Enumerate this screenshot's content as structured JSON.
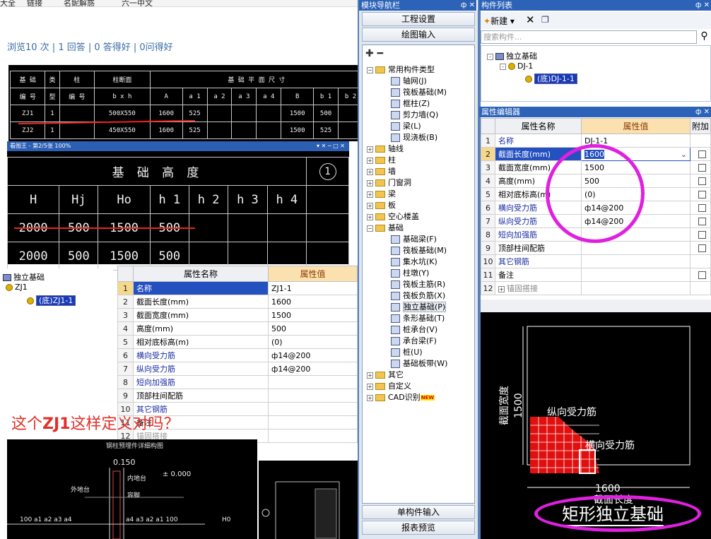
{
  "browser_bar": {
    "items": [
      "大全",
      "链接",
      "名妮解惑",
      "六一中文"
    ]
  },
  "stats": "浏览10 次 | 1 回答 | 0 答得好 | 0问得好",
  "cad_table1": {
    "header_row1": [
      "基 础",
      "类",
      "柱",
      "柱断面",
      "基 础 平 面 尺 寸"
    ],
    "header_row2": [
      "编 号",
      "型",
      "编 号",
      "b x h",
      "A",
      "a 1",
      "a 2",
      "a 3",
      "a 4",
      "B",
      "b 1",
      "b 2"
    ],
    "rows": [
      [
        "ZJ1",
        "1",
        "",
        "500X550",
        "1600",
        "525",
        "",
        "",
        "",
        "1500",
        "500",
        ""
      ],
      [
        "ZJ2",
        "1",
        "",
        "450X550",
        "1600",
        "525",
        "",
        "",
        "",
        "1500",
        "525",
        ""
      ]
    ]
  },
  "cad_window2": {
    "title": "看图王 - 第2/5张 100%",
    "heading": "基 础 高 度",
    "cols": [
      "H",
      "Hj",
      "Ho",
      "h 1",
      "h 2",
      "h 3",
      "h 4"
    ],
    "circle": "1",
    "rows": [
      [
        "2000",
        "500",
        "1500",
        "500",
        "",
        "",
        ""
      ],
      [
        "2000",
        "500",
        "1500",
        "500",
        "",
        "",
        ""
      ]
    ]
  },
  "left_tree": {
    "root": "独立基础",
    "child": "ZJ1",
    "leaf": "(底)ZJ1-1"
  },
  "left_props": {
    "head_name": "属性名称",
    "head_value": "属性值",
    "rows": [
      [
        "1",
        "名称",
        "ZJ1-1"
      ],
      [
        "2",
        "截面长度(mm)",
        "1600"
      ],
      [
        "3",
        "截面宽度(mm)",
        "1500"
      ],
      [
        "4",
        "高度(mm)",
        "500"
      ],
      [
        "5",
        "相对底标高(m)",
        "(0)"
      ],
      [
        "6",
        "横向受力筋",
        "ф14@200"
      ],
      [
        "7",
        "纵向受力筋",
        "ф14@200"
      ],
      [
        "8",
        "短向加强筋",
        ""
      ],
      [
        "9",
        "顶部柱间配筋",
        ""
      ],
      [
        "10",
        "其它钢筋",
        ""
      ],
      [
        "11",
        "备注",
        ""
      ],
      [
        "12",
        "锚固搭接",
        ""
      ]
    ]
  },
  "question": {
    "pre": "这个",
    "bold": "ZJ1",
    "post": "这样定义对吗？"
  },
  "drawing_labels": {
    "title": "钢柱预埋件详细构图",
    "elev": "0.150",
    "elev2": "± 0.000",
    "outer": "外地台",
    "inner": "内地台",
    "steps": "容脚",
    "dims": "100 a1 a2 a3 a4",
    "dims2": "a4 a3 a2 a1 100",
    "ho": "H0"
  },
  "module_nav": {
    "title": "模块导航栏",
    "btn_settings": "工程设置",
    "btn_drawing": "绘图输入",
    "btn_single": "单构件输入",
    "btn_report": "报表预览"
  },
  "nav_tree": [
    {
      "lvl": 0,
      "exp": "-",
      "kind": "folder",
      "label": "常用构件类型"
    },
    {
      "lvl": 1,
      "kind": "item",
      "label": "轴网(J)"
    },
    {
      "lvl": 1,
      "kind": "item",
      "label": "筏板基础(M)"
    },
    {
      "lvl": 1,
      "kind": "item",
      "label": "框柱(Z)"
    },
    {
      "lvl": 1,
      "kind": "item",
      "label": "剪力墙(Q)"
    },
    {
      "lvl": 1,
      "kind": "item",
      "label": "梁(L)"
    },
    {
      "lvl": 1,
      "kind": "item",
      "label": "现浇板(B)"
    },
    {
      "lvl": 0,
      "exp": "+",
      "kind": "folder",
      "label": "轴线"
    },
    {
      "lvl": 0,
      "exp": "+",
      "kind": "folder",
      "label": "柱"
    },
    {
      "lvl": 0,
      "exp": "+",
      "kind": "folder",
      "label": "墙"
    },
    {
      "lvl": 0,
      "exp": "+",
      "kind": "folder",
      "label": "门窗洞"
    },
    {
      "lvl": 0,
      "exp": "+",
      "kind": "folder",
      "label": "梁"
    },
    {
      "lvl": 0,
      "exp": "+",
      "kind": "folder",
      "label": "板"
    },
    {
      "lvl": 0,
      "exp": "+",
      "kind": "folder",
      "label": "空心楼盖"
    },
    {
      "lvl": 0,
      "exp": "-",
      "kind": "folder",
      "label": "基础"
    },
    {
      "lvl": 1,
      "kind": "item",
      "label": "基础梁(F)"
    },
    {
      "lvl": 1,
      "kind": "item",
      "label": "筏板基础(M)"
    },
    {
      "lvl": 1,
      "kind": "item",
      "label": "集水坑(K)"
    },
    {
      "lvl": 1,
      "kind": "item",
      "label": "柱墩(Y)"
    },
    {
      "lvl": 1,
      "kind": "item",
      "label": "筏板主筋(R)"
    },
    {
      "lvl": 1,
      "kind": "item",
      "label": "筏板负筋(X)"
    },
    {
      "lvl": 1,
      "kind": "item",
      "label": "独立基础(P)",
      "selected": true
    },
    {
      "lvl": 1,
      "kind": "item",
      "label": "条形基础(T)"
    },
    {
      "lvl": 1,
      "kind": "item",
      "label": "桩承台(V)"
    },
    {
      "lvl": 1,
      "kind": "item",
      "label": "承台梁(F)"
    },
    {
      "lvl": 1,
      "kind": "item",
      "label": "桩(U)"
    },
    {
      "lvl": 1,
      "kind": "item",
      "label": "基础板带(W)"
    },
    {
      "lvl": 0,
      "exp": "+",
      "kind": "folder",
      "label": "其它"
    },
    {
      "lvl": 0,
      "exp": "+",
      "kind": "folder",
      "label": "自定义"
    },
    {
      "lvl": 0,
      "exp": "+",
      "kind": "folder",
      "label": "CAD识别",
      "badge": "NEW"
    }
  ],
  "comp_list": {
    "title": "构件列表",
    "new_label": "新建",
    "search_placeholder": "搜索构件...",
    "root": "独立基础",
    "child": "DJ-1",
    "leaf": "(底)DJ-1-1"
  },
  "prop_editor": {
    "title": "属性编辑器",
    "head_name": "属性名称",
    "head_value": "属性值",
    "head_extra": "附加",
    "rows": [
      [
        "1",
        "名称",
        "DJ-1-1",
        false,
        "blue"
      ],
      [
        "2",
        "截面长度(mm)",
        "1600",
        true,
        "sel"
      ],
      [
        "3",
        "截面宽度(mm)",
        "1500",
        true,
        ""
      ],
      [
        "4",
        "高度(mm)",
        "500",
        true,
        ""
      ],
      [
        "5",
        "相对底标高(m)",
        "(0)",
        true,
        ""
      ],
      [
        "6",
        "横向受力筋",
        "ф14@200",
        true,
        "blue"
      ],
      [
        "7",
        "纵向受力筋",
        "ф14@200",
        true,
        "blue"
      ],
      [
        "8",
        "短向加强筋",
        "",
        true,
        "blue"
      ],
      [
        "9",
        "顶部柱间配筋",
        "",
        true,
        ""
      ],
      [
        "10",
        "其它钢筋",
        "",
        false,
        "blue"
      ],
      [
        "11",
        "备注",
        "",
        true,
        ""
      ],
      [
        "12",
        "锚固搭接",
        "",
        false,
        "grey"
      ]
    ]
  },
  "preview": {
    "width_label": "截面宽度",
    "width_val": "1500",
    "long_label": "纵向受力筋",
    "trans_label": "横向受力筋",
    "length_val": "1600",
    "length_label": "截面长度",
    "name": "矩形独立基础"
  },
  "colors": {
    "accent": "#2c63b8",
    "annotation": "#e020e0",
    "red": "#e0302a"
  }
}
